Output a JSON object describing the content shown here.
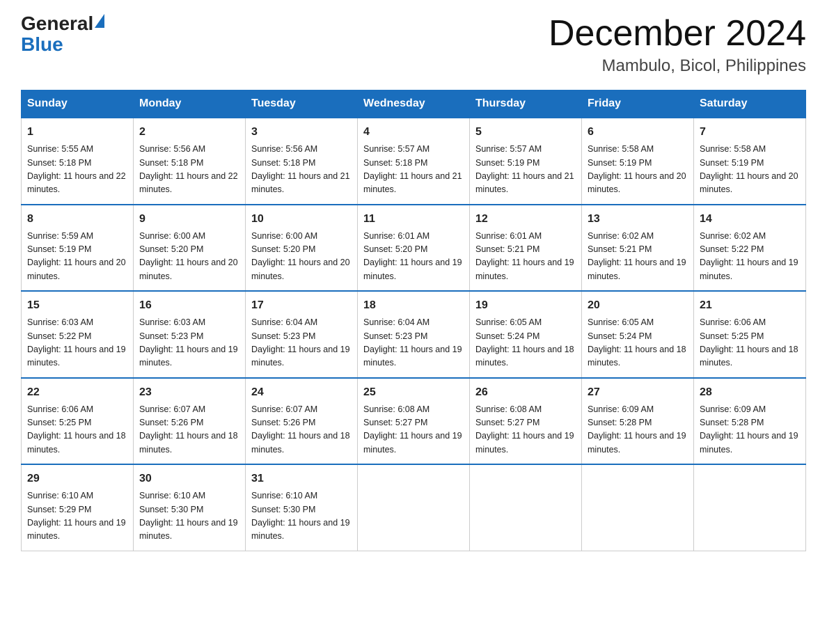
{
  "header": {
    "logo_general": "General",
    "logo_blue": "Blue",
    "month_title": "December 2024",
    "location": "Mambulo, Bicol, Philippines"
  },
  "weekdays": [
    "Sunday",
    "Monday",
    "Tuesday",
    "Wednesday",
    "Thursday",
    "Friday",
    "Saturday"
  ],
  "weeks": [
    [
      {
        "day": "1",
        "sunrise": "5:55 AM",
        "sunset": "5:18 PM",
        "daylight": "11 hours and 22 minutes."
      },
      {
        "day": "2",
        "sunrise": "5:56 AM",
        "sunset": "5:18 PM",
        "daylight": "11 hours and 22 minutes."
      },
      {
        "day": "3",
        "sunrise": "5:56 AM",
        "sunset": "5:18 PM",
        "daylight": "11 hours and 21 minutes."
      },
      {
        "day": "4",
        "sunrise": "5:57 AM",
        "sunset": "5:18 PM",
        "daylight": "11 hours and 21 minutes."
      },
      {
        "day": "5",
        "sunrise": "5:57 AM",
        "sunset": "5:19 PM",
        "daylight": "11 hours and 21 minutes."
      },
      {
        "day": "6",
        "sunrise": "5:58 AM",
        "sunset": "5:19 PM",
        "daylight": "11 hours and 20 minutes."
      },
      {
        "day": "7",
        "sunrise": "5:58 AM",
        "sunset": "5:19 PM",
        "daylight": "11 hours and 20 minutes."
      }
    ],
    [
      {
        "day": "8",
        "sunrise": "5:59 AM",
        "sunset": "5:19 PM",
        "daylight": "11 hours and 20 minutes."
      },
      {
        "day": "9",
        "sunrise": "6:00 AM",
        "sunset": "5:20 PM",
        "daylight": "11 hours and 20 minutes."
      },
      {
        "day": "10",
        "sunrise": "6:00 AM",
        "sunset": "5:20 PM",
        "daylight": "11 hours and 20 minutes."
      },
      {
        "day": "11",
        "sunrise": "6:01 AM",
        "sunset": "5:20 PM",
        "daylight": "11 hours and 19 minutes."
      },
      {
        "day": "12",
        "sunrise": "6:01 AM",
        "sunset": "5:21 PM",
        "daylight": "11 hours and 19 minutes."
      },
      {
        "day": "13",
        "sunrise": "6:02 AM",
        "sunset": "5:21 PM",
        "daylight": "11 hours and 19 minutes."
      },
      {
        "day": "14",
        "sunrise": "6:02 AM",
        "sunset": "5:22 PM",
        "daylight": "11 hours and 19 minutes."
      }
    ],
    [
      {
        "day": "15",
        "sunrise": "6:03 AM",
        "sunset": "5:22 PM",
        "daylight": "11 hours and 19 minutes."
      },
      {
        "day": "16",
        "sunrise": "6:03 AM",
        "sunset": "5:23 PM",
        "daylight": "11 hours and 19 minutes."
      },
      {
        "day": "17",
        "sunrise": "6:04 AM",
        "sunset": "5:23 PM",
        "daylight": "11 hours and 19 minutes."
      },
      {
        "day": "18",
        "sunrise": "6:04 AM",
        "sunset": "5:23 PM",
        "daylight": "11 hours and 19 minutes."
      },
      {
        "day": "19",
        "sunrise": "6:05 AM",
        "sunset": "5:24 PM",
        "daylight": "11 hours and 18 minutes."
      },
      {
        "day": "20",
        "sunrise": "6:05 AM",
        "sunset": "5:24 PM",
        "daylight": "11 hours and 18 minutes."
      },
      {
        "day": "21",
        "sunrise": "6:06 AM",
        "sunset": "5:25 PM",
        "daylight": "11 hours and 18 minutes."
      }
    ],
    [
      {
        "day": "22",
        "sunrise": "6:06 AM",
        "sunset": "5:25 PM",
        "daylight": "11 hours and 18 minutes."
      },
      {
        "day": "23",
        "sunrise": "6:07 AM",
        "sunset": "5:26 PM",
        "daylight": "11 hours and 18 minutes."
      },
      {
        "day": "24",
        "sunrise": "6:07 AM",
        "sunset": "5:26 PM",
        "daylight": "11 hours and 18 minutes."
      },
      {
        "day": "25",
        "sunrise": "6:08 AM",
        "sunset": "5:27 PM",
        "daylight": "11 hours and 19 minutes."
      },
      {
        "day": "26",
        "sunrise": "6:08 AM",
        "sunset": "5:27 PM",
        "daylight": "11 hours and 19 minutes."
      },
      {
        "day": "27",
        "sunrise": "6:09 AM",
        "sunset": "5:28 PM",
        "daylight": "11 hours and 19 minutes."
      },
      {
        "day": "28",
        "sunrise": "6:09 AM",
        "sunset": "5:28 PM",
        "daylight": "11 hours and 19 minutes."
      }
    ],
    [
      {
        "day": "29",
        "sunrise": "6:10 AM",
        "sunset": "5:29 PM",
        "daylight": "11 hours and 19 minutes."
      },
      {
        "day": "30",
        "sunrise": "6:10 AM",
        "sunset": "5:30 PM",
        "daylight": "11 hours and 19 minutes."
      },
      {
        "day": "31",
        "sunrise": "6:10 AM",
        "sunset": "5:30 PM",
        "daylight": "11 hours and 19 minutes."
      },
      null,
      null,
      null,
      null
    ]
  ]
}
